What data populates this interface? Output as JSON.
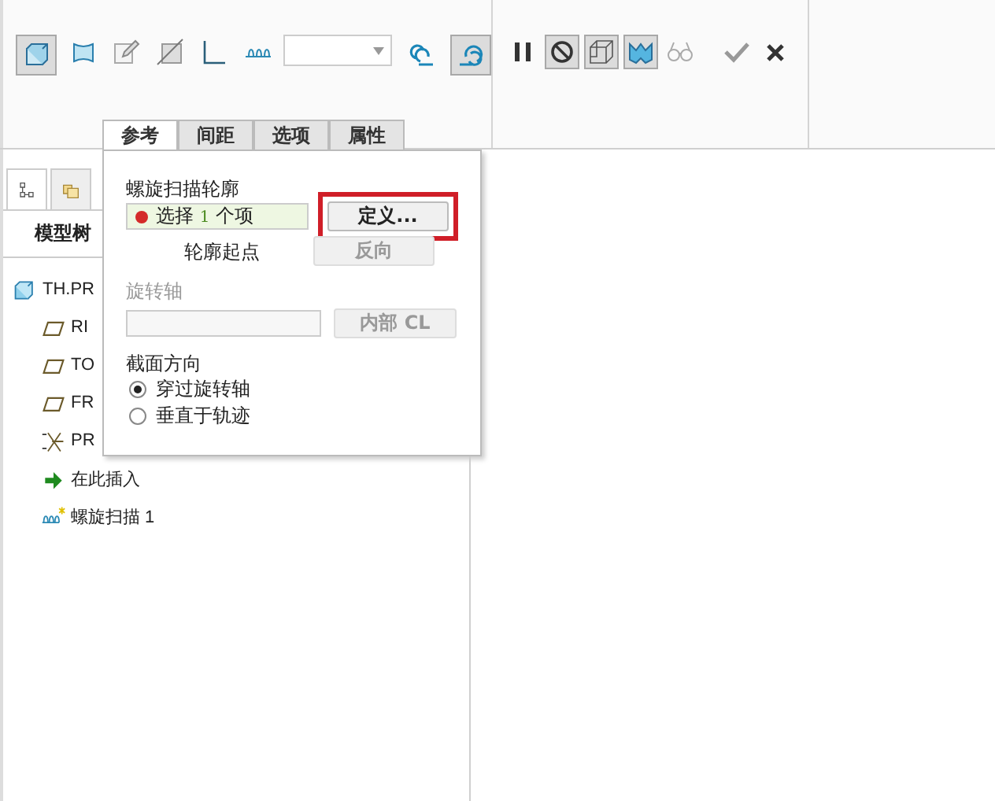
{
  "toolbar": {
    "feature_tools": [
      {
        "selected": true
      },
      {
        "selected": false
      },
      {
        "selected": false
      },
      {
        "selected": false
      },
      {
        "selected": false
      },
      {
        "selected": false
      }
    ],
    "handedness_tools": [
      {
        "selected": false
      },
      {
        "selected": true
      }
    ],
    "control_tools": [
      {
        "selected": false
      },
      {
        "selected": true
      },
      {
        "selected": true
      },
      {
        "selected": true
      },
      {
        "selected": false
      }
    ]
  },
  "dashboard_tabs": [
    {
      "label": "参考",
      "selected": true
    },
    {
      "label": "间距",
      "selected": false
    },
    {
      "label": "选项",
      "selected": false
    },
    {
      "label": "属性",
      "selected": false
    }
  ],
  "references_panel": {
    "profile_label": "螺旋扫描轮廓",
    "profile_collector": {
      "text": "选择 **1** 个项"
    },
    "define_button": {
      "label": "定义...",
      "highlighted": true
    },
    "start_point_label": "轮廓起点",
    "flip_button": {
      "label": "反向",
      "disabled": true
    },
    "axis_label": {
      "text": "旋转轴",
      "disabled": true
    },
    "axis_button": {
      "label": "内部 CL",
      "disabled": true
    },
    "orientation_label": "截面方向",
    "orientation_options": [
      {
        "label": "穿过旋转轴",
        "selected": true
      },
      {
        "label": "垂直于轨迹",
        "selected": false
      }
    ]
  },
  "left_panel": {
    "tabs": [
      {
        "selected": true
      },
      {
        "selected": false
      }
    ],
    "title": "模型树",
    "tree": [
      {
        "label": "TH.PR",
        "kind": "part",
        "children": [
          {
            "label": "RI",
            "kind": "plane"
          },
          {
            "label": "TO",
            "kind": "plane"
          },
          {
            "label": "FR",
            "kind": "plane"
          },
          {
            "label": "PR",
            "kind": "csys"
          },
          {
            "label": "在此插入",
            "kind": "insert"
          },
          {
            "label": "螺旋扫描 1",
            "kind": "helix"
          }
        ]
      }
    ]
  }
}
